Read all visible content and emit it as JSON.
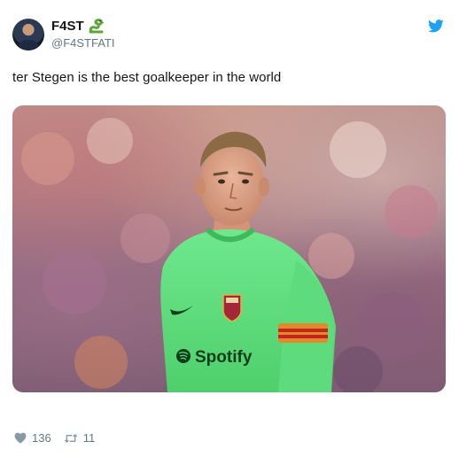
{
  "tweet": {
    "display_name": "F4ST",
    "name_emoji_icon": "snake-icon",
    "handle": "@F4STFATI",
    "platform_icon": "twitter-bird-icon",
    "text": "ter Stegen is the best goalkeeper in the world",
    "likes": "136",
    "retweets": "11"
  },
  "colors": {
    "twitter_blue": "#1da1f2",
    "text": "#14171a",
    "muted": "#657786",
    "jersey_green": "#57e07a"
  }
}
